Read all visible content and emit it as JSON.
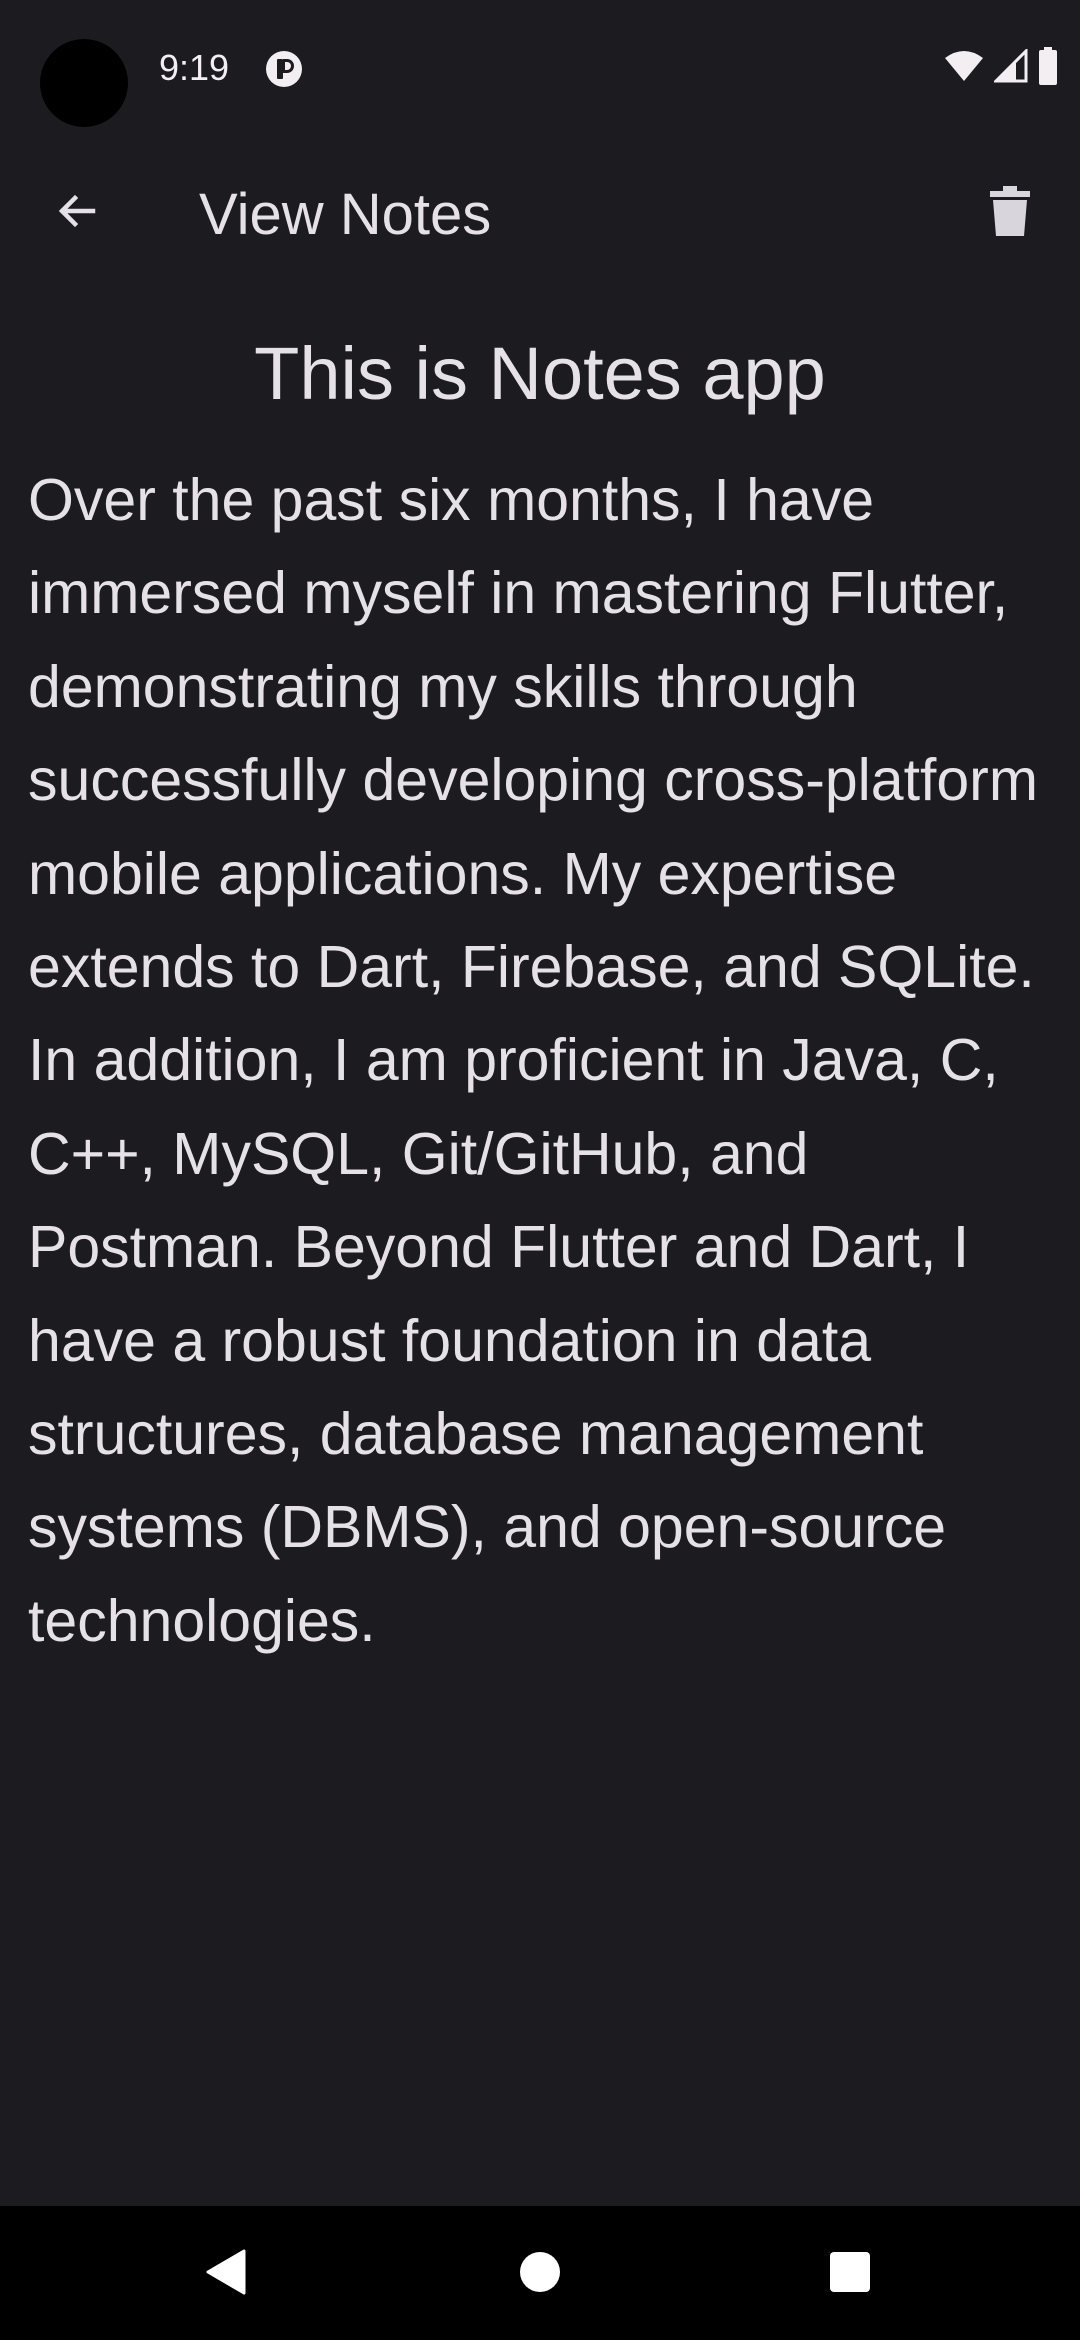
{
  "status_bar": {
    "time": "9:19",
    "notification_icon": "app-notification-icon",
    "wifi_icon": "wifi-icon",
    "signal_icon": "cell-signal-icon",
    "battery_icon": "battery-icon"
  },
  "app_bar": {
    "title": "View Notes",
    "back_icon": "arrow-back-icon",
    "delete_icon": "trash-icon"
  },
  "note": {
    "title": "This is Notes app",
    "body": "Over the past six months, I have immersed myself in mastering Flutter, demonstrating my skills through successfully developing cross-platform mobile applications. My expertise extends to Dart, Firebase, and SQLite. In addition, I am proficient in Java, C, C++, MySQL, Git/GitHub, and Postman. Beyond Flutter and Dart, I have a robust foundation in data structures, database management systems (DBMS), and open-source technologies."
  },
  "nav_bar": {
    "back_icon": "nav-back-triangle-icon",
    "home_icon": "nav-home-circle-icon",
    "recents_icon": "nav-recents-square-icon"
  },
  "colors": {
    "background": "#1c1b20",
    "text": "#e6e1e6",
    "nav_background": "#000000"
  }
}
